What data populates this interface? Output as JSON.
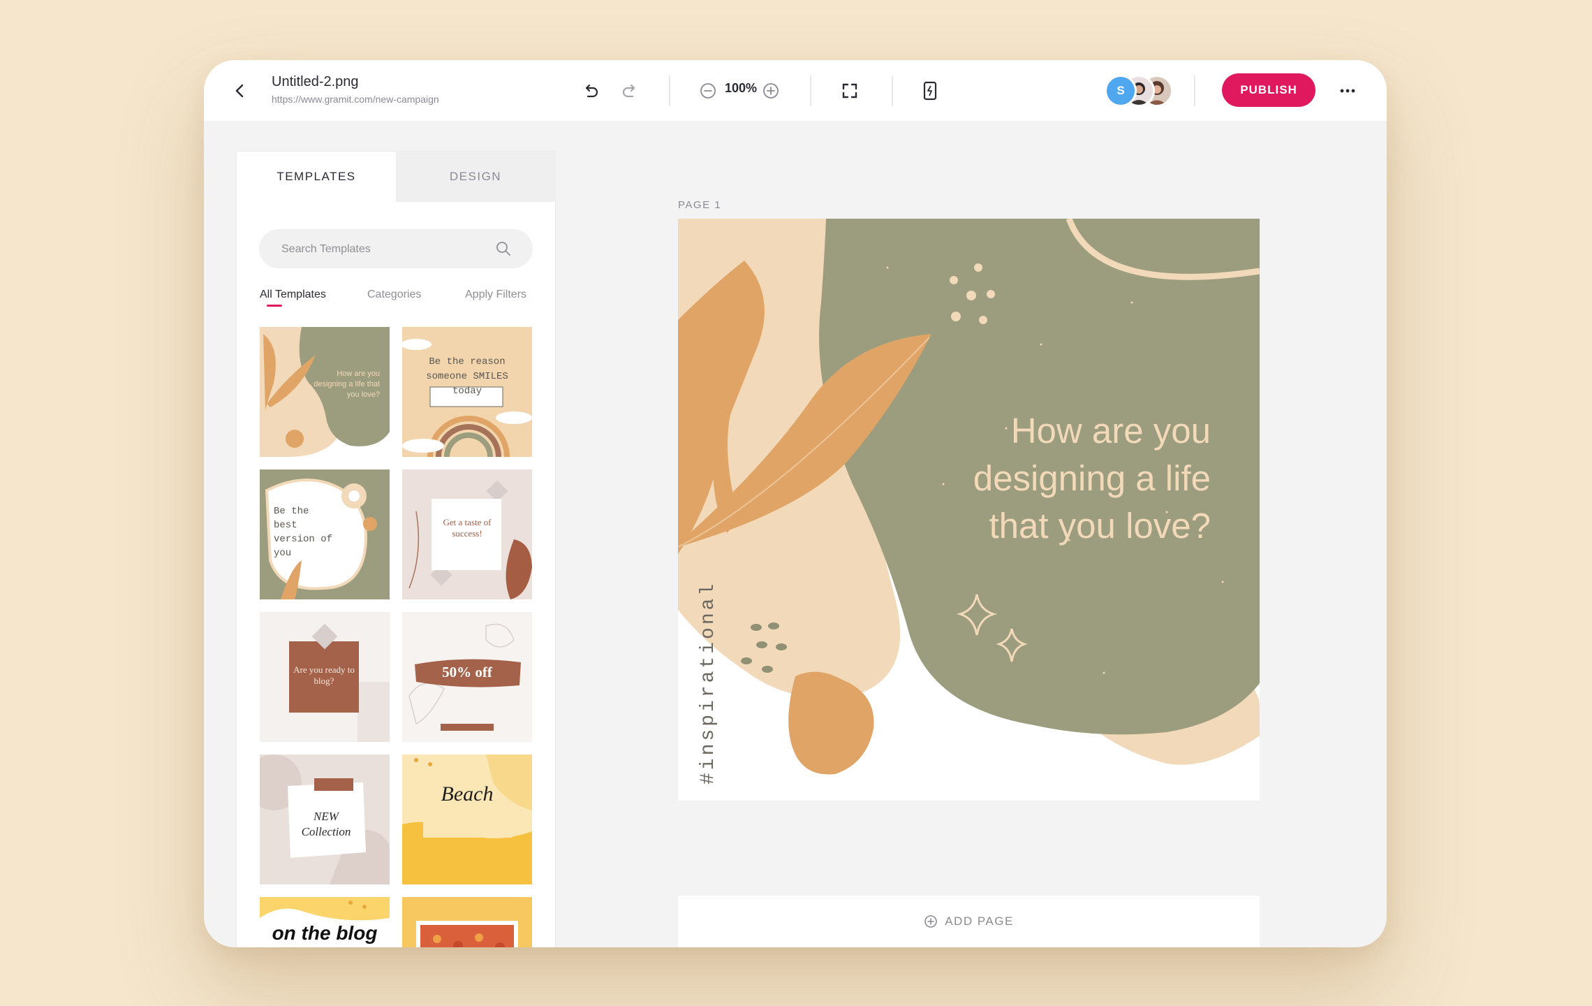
{
  "header": {
    "file_name": "Untitled-2.png",
    "file_url": "https://www.gramit.com/new-campaign",
    "zoom": "100%",
    "avatar_initial": "S",
    "publish_label": "PUBLISH"
  },
  "sidebar": {
    "tabs": [
      {
        "label": "TEMPLATES",
        "active": true
      },
      {
        "label": "DESIGN",
        "active": false
      }
    ],
    "search_placeholder": "Search Templates",
    "filters": [
      "All Templates",
      "Categories",
      "Apply Filters"
    ],
    "templates": [
      {
        "text": "How are you designing a life that you love?"
      },
      {
        "text": "Be the reason someone SMILES today"
      },
      {
        "text": "Be the best version of you"
      },
      {
        "text": "Get a taste of success!"
      },
      {
        "text": "Are you ready to blog?"
      },
      {
        "text": "50% off"
      },
      {
        "text": "NEW Collection"
      },
      {
        "text": "Beach"
      },
      {
        "text": "on the blog"
      },
      {
        "text": ""
      }
    ]
  },
  "canvas": {
    "page_label": "PAGE 1",
    "headline_line1": "How are you",
    "headline_line2": "designing a life",
    "headline_line3": "that you love?",
    "vertical_tag": "#inspirational",
    "add_page_label": "ADD PAGE",
    "colors": {
      "sage": "#9c9d7e",
      "beige": "#f2d9b9",
      "orange": "#e0a566",
      "background": "#ffffff"
    }
  },
  "colors": {
    "accent": "#e0195f",
    "page_background": "#f5e6cc"
  }
}
